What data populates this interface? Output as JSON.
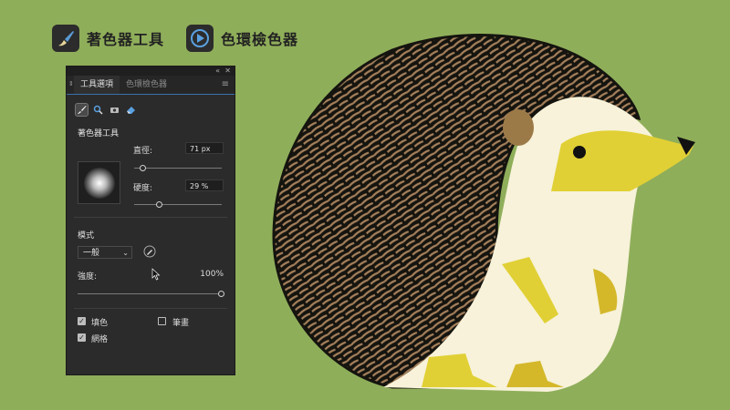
{
  "legend": {
    "brush_tool": "著色器工具",
    "color_wheel": "色環檢色器"
  },
  "panel": {
    "tabs": [
      "工具選項",
      "色環檢色器"
    ],
    "section_title": "著色器工具",
    "diameter_label": "直徑:",
    "diameter_value": "71 px",
    "diameter_fraction": 0.1,
    "hardness_label": "硬度:",
    "hardness_value": "29 %",
    "hardness_fraction": 0.29,
    "mode_label": "模式",
    "mode_value": "一般",
    "strength_label": "強度:",
    "strength_value": "100%",
    "strength_fraction": 1.0,
    "fill_label": "填色",
    "stroke_label": "筆畫",
    "grid_label": "網格",
    "fill_checked": true,
    "stroke_checked": false,
    "grid_checked": true
  },
  "icons": [
    "brush-icon",
    "magnifier-icon",
    "camera-icon",
    "eraser-icon",
    "color-wheel-icon",
    "eyedropper-icon"
  ],
  "colors": {
    "background": "#8fae5a",
    "panel": "#2b2b2b",
    "spikes": "#a5805b",
    "body": "#f7f2d9",
    "face": "#e1d035",
    "accent": "#3c6fa8"
  }
}
